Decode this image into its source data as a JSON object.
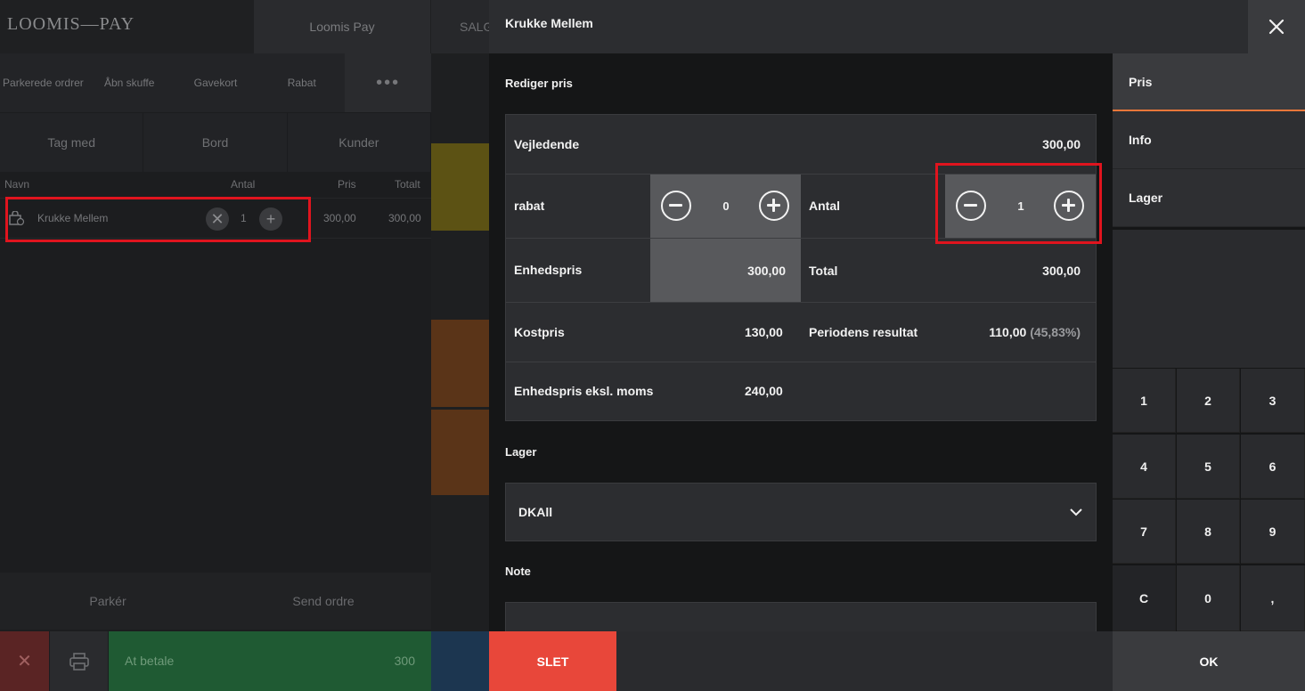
{
  "pos": {
    "logo": "LOOMIS—PAY",
    "brand_button": "Loomis Pay",
    "salg_tab": "SALG",
    "functions": [
      "Parkerede ordrer",
      "Åbn skuffe",
      "Gavekort",
      "Rabat",
      "•••"
    ],
    "modes": [
      "Tag med",
      "Bord",
      "Kunder"
    ],
    "columns": {
      "name": "Navn",
      "qty": "Antal",
      "price": "Pris",
      "total": "Totalt"
    },
    "order_line": {
      "name": "Krukke Mellem",
      "qty": "1",
      "price": "300,00",
      "total": "300,00"
    },
    "park": "Parkér",
    "send": "Send ordre",
    "pay_label": "At betale",
    "pay_amount": "300"
  },
  "dialog": {
    "title": "Krukke Mellem",
    "edit_price_label": "Rediger pris",
    "rows": {
      "vejledende_label": "Vejledende",
      "vejledende_value": "300,00",
      "rabat_label": "rabat",
      "rabat_value": "0",
      "antal_label": "Antal",
      "antal_value": "1",
      "enhedspris_label": "Enhedspris",
      "enhedspris_value": "300,00",
      "total_label": "Total",
      "total_value": "300,00",
      "kostpris_label": "Kostpris",
      "kostpris_value": "130,00",
      "resultat_label": "Periodens resultat",
      "resultat_value": "110,00",
      "resultat_percent": "(45,83%)",
      "eksl_label": "Enhedspris eksl. moms",
      "eksl_value": "240,00"
    },
    "lager_label": "Lager",
    "lager_value": "DKAll",
    "note_label": "Note",
    "delete_button": "SLET",
    "tabs": [
      "Pris",
      "Info",
      "Lager"
    ],
    "keypad": [
      "1",
      "2",
      "3",
      "4",
      "5",
      "6",
      "7",
      "8",
      "9",
      "C",
      "0",
      ","
    ],
    "ok_button": "OK"
  },
  "colors": {
    "accent": "#e8773a",
    "delete": "#e8473a",
    "highlight": "#e0141e",
    "pay": "#1f5a33"
  }
}
